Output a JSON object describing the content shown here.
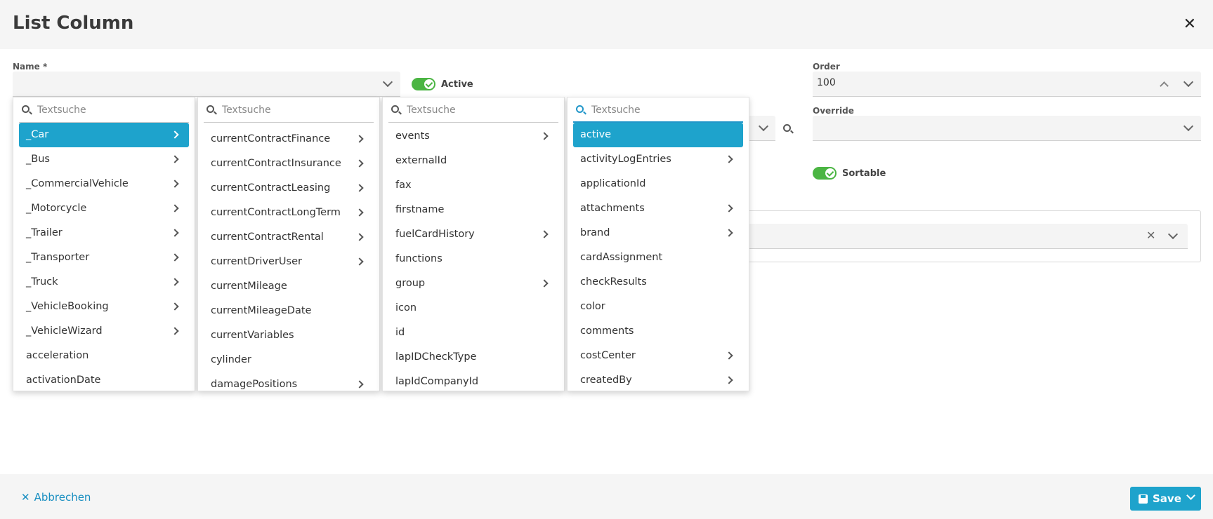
{
  "dialog": {
    "title": "List Column"
  },
  "form": {
    "name_label": "Name *",
    "name_value": "",
    "active_label": "Active",
    "order_label": "Order",
    "order_value": "100",
    "override_label": "Override",
    "override_value": "",
    "sortable_label": "Sortable"
  },
  "columns": [
    {
      "placeholder": "Textsuche",
      "items": [
        {
          "label": "_Car",
          "has_children": true,
          "selected": true
        },
        {
          "label": "_Bus",
          "has_children": true
        },
        {
          "label": "_CommercialVehicle",
          "has_children": true
        },
        {
          "label": "_Motorcycle",
          "has_children": true
        },
        {
          "label": "_Trailer",
          "has_children": true
        },
        {
          "label": "_Transporter",
          "has_children": true
        },
        {
          "label": "_Truck",
          "has_children": true
        },
        {
          "label": "_VehicleBooking",
          "has_children": true
        },
        {
          "label": "_VehicleWizard",
          "has_children": true
        },
        {
          "label": "acceleration",
          "has_children": false
        },
        {
          "label": "activationDate",
          "has_children": false
        }
      ]
    },
    {
      "placeholder": "Textsuche",
      "items": [
        {
          "label": "currentContractFinance",
          "has_children": true
        },
        {
          "label": "currentContractInsurance",
          "has_children": true
        },
        {
          "label": "currentContractLeasing",
          "has_children": true
        },
        {
          "label": "currentContractLongTerm",
          "has_children": true
        },
        {
          "label": "currentContractRental",
          "has_children": true
        },
        {
          "label": "currentDriverUser",
          "has_children": true
        },
        {
          "label": "currentMileage",
          "has_children": false
        },
        {
          "label": "currentMileageDate",
          "has_children": false
        },
        {
          "label": "currentVariables",
          "has_children": false
        },
        {
          "label": "cylinder",
          "has_children": false
        },
        {
          "label": "damagePositions",
          "has_children": true
        }
      ]
    },
    {
      "placeholder": "Textsuche",
      "items": [
        {
          "label": "events",
          "has_children": true
        },
        {
          "label": "externalId",
          "has_children": false
        },
        {
          "label": "fax",
          "has_children": false
        },
        {
          "label": "firstname",
          "has_children": false
        },
        {
          "label": "fuelCardHistory",
          "has_children": true
        },
        {
          "label": "functions",
          "has_children": false
        },
        {
          "label": "group",
          "has_children": true
        },
        {
          "label": "icon",
          "has_children": false
        },
        {
          "label": "id",
          "has_children": false
        },
        {
          "label": "lapIDCheckType",
          "has_children": false
        },
        {
          "label": "lapIdCompanyId",
          "has_children": false
        }
      ]
    },
    {
      "placeholder": "Textsuche",
      "items": [
        {
          "label": "active",
          "has_children": false,
          "selected": true
        },
        {
          "label": "activityLogEntries",
          "has_children": true
        },
        {
          "label": "applicationId",
          "has_children": false
        },
        {
          "label": "attachments",
          "has_children": true
        },
        {
          "label": "brand",
          "has_children": true
        },
        {
          "label": "cardAssignment",
          "has_children": false
        },
        {
          "label": "checkResults",
          "has_children": false
        },
        {
          "label": "color",
          "has_children": false
        },
        {
          "label": "comments",
          "has_children": false
        },
        {
          "label": "costCenter",
          "has_children": true
        },
        {
          "label": "createdBy",
          "has_children": true
        }
      ]
    }
  ],
  "footer": {
    "cancel_label": "Abbrechen",
    "save_label": "Save"
  },
  "colors": {
    "accent": "#1ea3cc",
    "toggle_on": "#4bb543",
    "link": "#1a8fc1"
  },
  "icons": {
    "close": "close-icon",
    "search": "search-icon",
    "save": "save-icon",
    "chevron": "chevron-right-icon"
  }
}
